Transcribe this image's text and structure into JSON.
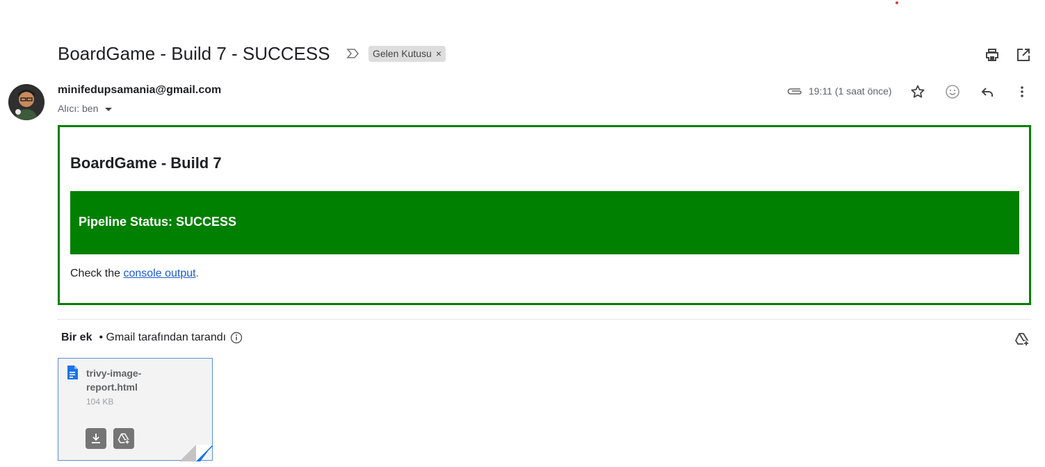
{
  "email": {
    "subject": "BoardGame - Build 7 - SUCCESS",
    "label": "Gelen Kutusu",
    "label_remove": "×",
    "sender": "minifedupsamania@gmail.com",
    "to_text": "Alıcı: ben",
    "time": "19:11 (1 saat önce)"
  },
  "body": {
    "build_title": "BoardGame - Build 7",
    "status_text": "Pipeline Status: SUCCESS",
    "check_prefix": "Check the ",
    "link_text": "console output",
    "check_suffix": ".",
    "accent_color": "#008000"
  },
  "attachments": {
    "count_label": "Bir ek",
    "scanned_text": "• Gmail tarafından tarandı",
    "file": {
      "name": "trivy-image-report.html",
      "size": "104 KB"
    }
  },
  "icons": [
    "important-marker-icon",
    "print-icon",
    "open-in-new-window-icon",
    "paperclip-icon",
    "star-icon",
    "emoji-icon",
    "reply-icon",
    "more-vert-icon",
    "info-icon",
    "add-to-drive-icon",
    "document-icon",
    "download-icon"
  ]
}
